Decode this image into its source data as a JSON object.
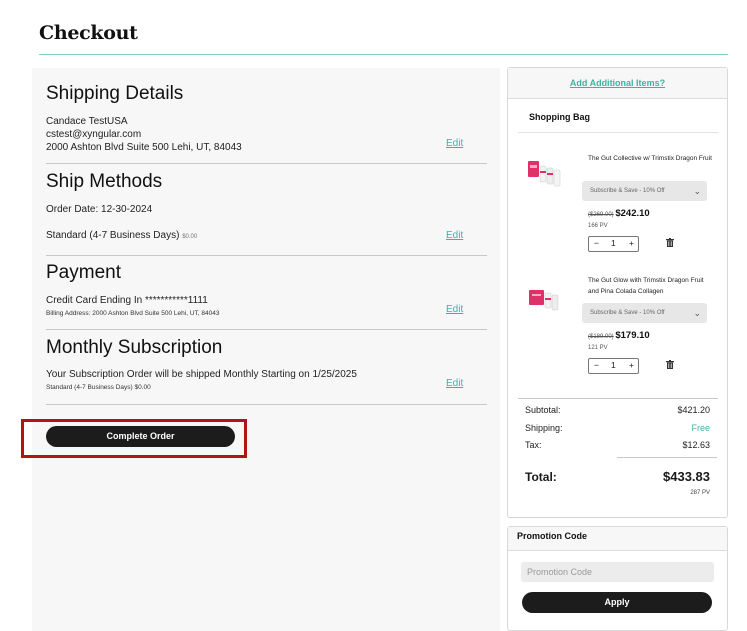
{
  "page": {
    "title": "Checkout"
  },
  "shipping": {
    "title": "Shipping Details",
    "name": "Candace TestUSA",
    "email": "cstest@xyngular.com",
    "address": "2000 Ashton Blvd Suite 500 Lehi, UT, 84043",
    "edit": "Edit"
  },
  "ship_methods": {
    "title": "Ship Methods",
    "order_date": "Order Date: 12-30-2024",
    "method": "Standard (4-7 Business Days)",
    "method_price": "$0.00",
    "edit": "Edit"
  },
  "payment": {
    "title": "Payment",
    "card": "Credit Card Ending In ***********1111",
    "billing": "Billing Address: 2000 Ashton Blvd Suite 500 Lehi, UT, 84043",
    "edit": "Edit"
  },
  "subscription": {
    "title": "Monthly Subscription",
    "text": "Your Subscription Order will be shipped Monthly Starting on 1/25/2025",
    "method": "Standard (4-7 Business Days) $0.00",
    "edit": "Edit"
  },
  "complete_button": "Complete Order",
  "bag": {
    "add_items": "Add Additional Items?",
    "title": "Shopping Bag",
    "items": [
      {
        "name": "The Gut Collective w/ Trimstix Dragon Fruit",
        "option": "Subscribe & Save - 10% Off",
        "old_price": "($269.00)",
        "price": "$242.10",
        "pv": "166 PV",
        "qty": "1"
      },
      {
        "name": "The Gut Glow with Trimstix Dragon Fruit and Pina Colada Collagen",
        "option": "Subscribe & Save - 10% Off",
        "old_price": "($189.00)",
        "price": "$179.10",
        "pv": "121 PV",
        "qty": "1"
      }
    ],
    "qty_minus": "−",
    "qty_plus": "+"
  },
  "summary": {
    "subtotal_label": "Subtotal:",
    "subtotal": "$421.20",
    "shipping_label": "Shipping:",
    "shipping": "Free",
    "tax_label": "Tax:",
    "tax": "$12.63",
    "total_label": "Total:",
    "total": "$433.83",
    "total_pv": "287 PV"
  },
  "promo": {
    "title": "Promotion Code",
    "placeholder": "Promotion Code",
    "apply": "Apply"
  },
  "colors": {
    "accent": "#3bb3a3",
    "highlight": "#b01515",
    "button": "#1c1c1c"
  }
}
